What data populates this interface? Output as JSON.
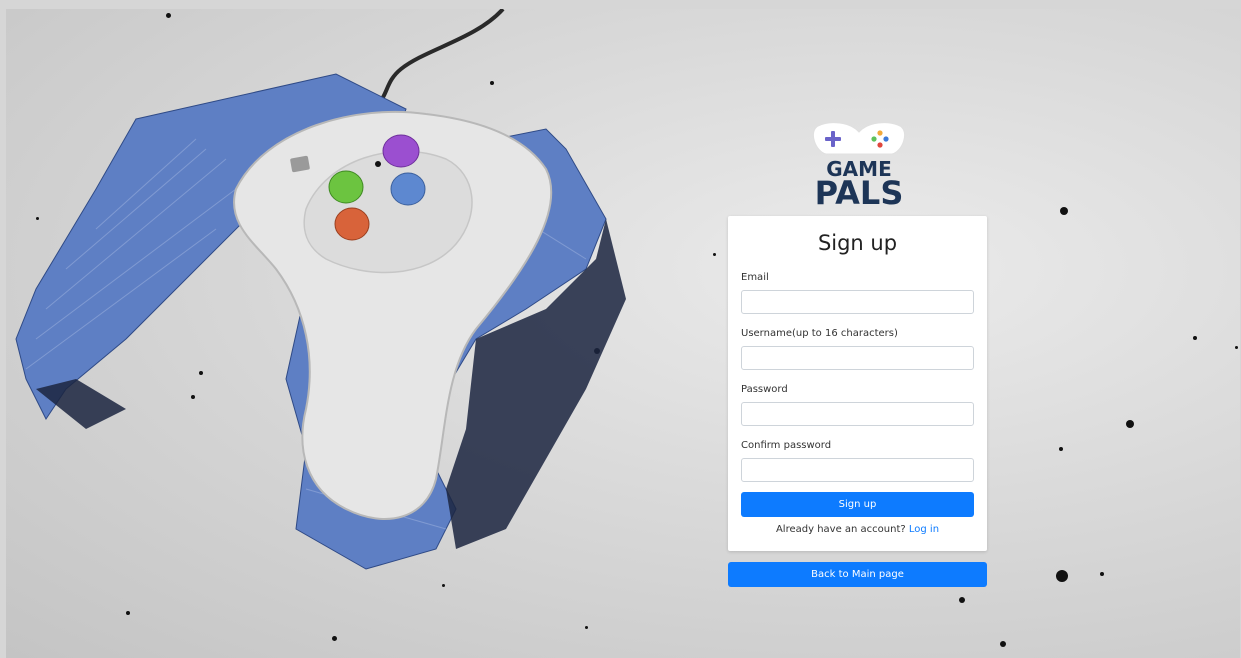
{
  "brand": {
    "line1": "GAME",
    "line2": "PALS"
  },
  "form": {
    "title": "Sign up",
    "email_label": "Email",
    "email_value": "",
    "username_label": "Username(up to 16 characters)",
    "username_value": "",
    "password_label": "Password",
    "password_value": "",
    "confirm_label": "Confirm password",
    "confirm_value": "",
    "submit_label": "Sign up",
    "account_prompt": "Already have an account?",
    "login_link": "Log in"
  },
  "back_button": "Back to Main page",
  "colors": {
    "primary": "#0d7bff",
    "brand_navy": "#1d3557"
  }
}
